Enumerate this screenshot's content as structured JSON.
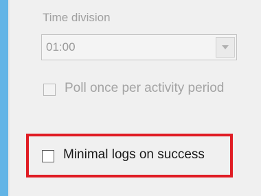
{
  "time_division": {
    "label": "Time division",
    "value": "01:00"
  },
  "poll_once": {
    "label": "Poll once per activity period",
    "checked": false,
    "enabled": false
  },
  "minimal_logs": {
    "label": "Minimal logs on success",
    "checked": false,
    "enabled": true
  },
  "colors": {
    "accent_strip": "#62b4e6",
    "highlight_box": "#e01c24"
  },
  "icons": [
    "chevron-down-icon"
  ]
}
